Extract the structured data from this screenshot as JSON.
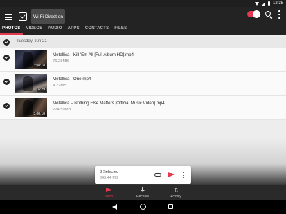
{
  "status_bar": {
    "time": "12:38"
  },
  "header": {
    "tooltip": "Wi-Fi Direct on",
    "accent_color": "#e53950",
    "tabs": [
      {
        "label": "PHOTOS",
        "active": true
      },
      {
        "label": "VIDEOS",
        "active": false
      },
      {
        "label": "AUDIO",
        "active": false
      },
      {
        "label": "APPS",
        "active": false
      },
      {
        "label": "CONTACTS",
        "active": false
      },
      {
        "label": "FILES",
        "active": false
      }
    ]
  },
  "date_group": {
    "label": "Tuesday, Jun 21"
  },
  "items": [
    {
      "name": "Metallica - Kill 'Em All [Full Album HD].mp4",
      "size": "76.28MB",
      "duration": "3:08:18"
    },
    {
      "name": "Metallica - One.mp4",
      "size": "4.22MB",
      "duration": "6:29"
    },
    {
      "name": "Metallica – Nothing Else Matters [Official Music Video].mp4",
      "size": "224.59MB",
      "duration": "3:08:18"
    }
  ],
  "selection": {
    "count_label": "3 Selected",
    "total_size": "643.44 MB"
  },
  "bottom_nav": [
    {
      "label": "Send",
      "active": true
    },
    {
      "label": "Receive",
      "active": false
    },
    {
      "label": "Activity",
      "active": false
    }
  ]
}
